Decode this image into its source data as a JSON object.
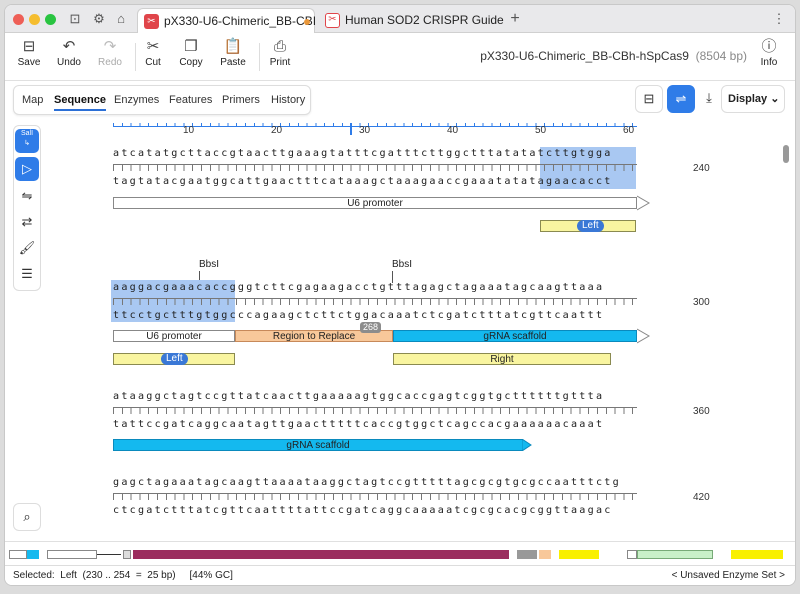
{
  "tabs": [
    {
      "title": "pX330-U6-Chimeric_BB-CBI",
      "modified": true
    },
    {
      "title": "Human SOD2 CRISPR Guide"
    }
  ],
  "toolbar": {
    "save": "Save",
    "undo": "Undo",
    "redo": "Redo",
    "cut": "Cut",
    "copy": "Copy",
    "paste": "Paste",
    "print": "Print",
    "info": "Info"
  },
  "document": {
    "title": "pX330-U6-Chimeric_BB-CBh-hSpCas9",
    "length": "(8504 bp)"
  },
  "view_tabs": [
    "Map",
    "Sequence",
    "Enzymes",
    "Features",
    "Primers",
    "History"
  ],
  "display_label": "Display",
  "ruler": {
    "ticks": [
      "10",
      "20",
      "30",
      "40",
      "50",
      "60"
    ]
  },
  "rows": [
    {
      "number": "240",
      "top": "atcatatgcttaccgtaacttgaaagtatttcgatttcttggctttatatatcttgtgga",
      "bottom": "tagtatacgaatggcattgaactttcataaagctaaagaaccgaaatatatagaacacct",
      "features": [
        {
          "label": "U6 promoter"
        }
      ],
      "primers": [
        {
          "label": "Left"
        }
      ]
    },
    {
      "number": "300",
      "top": "aaggacgaaacaccgggtcttcgagaagacctgtttagagctagaaatagcaagttaaa",
      "bottom": "ttcctgctttgtggcccagaagctcttctggacaaatctcgatctttatcgttcaattt",
      "cut_sites": [
        "BbsI",
        "BbsI"
      ],
      "features": [
        {
          "label": "U6 promoter"
        },
        {
          "label": "Region to Replace"
        },
        {
          "label": "gRNA scaffold"
        }
      ],
      "badge": "268",
      "primers": [
        {
          "label": "Left"
        },
        {
          "label": "Right"
        }
      ]
    },
    {
      "number": "360",
      "top": "ataaggctagtccgttatcaacttgaaaaagtggcaccgagtcggtgcttttttgttta",
      "bottom": "tattccgatcaggcaatagttgaactttttcaccgtggctcagccacgaaaaaacaaat",
      "features": [
        {
          "label": "gRNA scaffold"
        }
      ]
    },
    {
      "number": "420",
      "top": "gagctagaaatagcaagttaaaataaggctagtccgtttttagcgcgtgcgccaatttctg",
      "bottom": "ctcgatctttatcgttcaattttattccgatcaggcaaaaatcgcgcacgcggttaagac"
    }
  ],
  "status": {
    "selected": "Selected:  Left  (230 .. 254  =  25 bp)     [44% GC]",
    "enzyme_set": "< Unsaved Enzyme Set >"
  },
  "colors": {
    "accent": "#2f7ce8",
    "scaffold": "#14b9ef",
    "primer": "#f9f5a0",
    "region": "#f8c89a",
    "cas9": "#9b2d5e",
    "tab_icon": "#e0454a"
  }
}
